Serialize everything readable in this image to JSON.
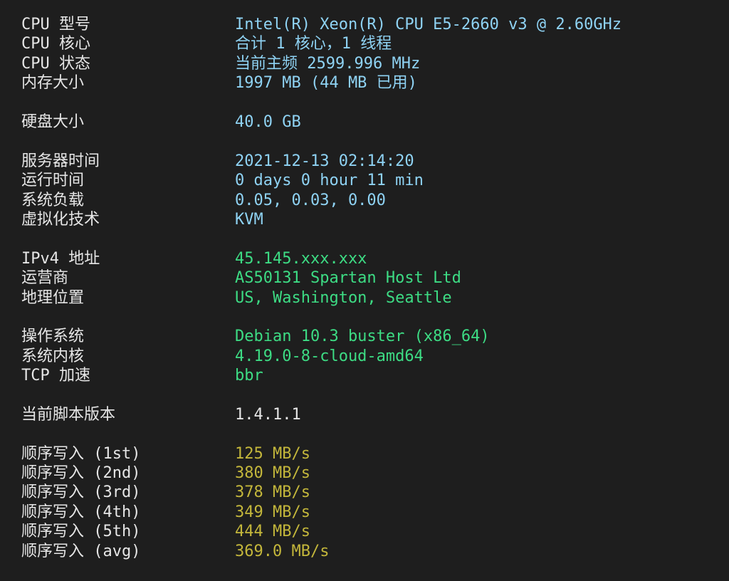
{
  "colors": {
    "background": "#1e1e1e",
    "label": "#e6e6e6",
    "system_value": "#8fd3f4",
    "network_os_value": "#3ddc84",
    "script_version_value": "#e6e6e6",
    "io_value": "#c4b73b"
  },
  "system": [
    {
      "label": "CPU 型号",
      "value": "Intel(R) Xeon(R) CPU E5-2660 v3 @ 2.60GHz"
    },
    {
      "label": "CPU 核心",
      "value": "合计 1 核心，1 线程"
    },
    {
      "label": "CPU 状态",
      "value": "当前主频 2599.996 MHz"
    },
    {
      "label": "内存大小",
      "value": "1997 MB (44 MB 已用)"
    },
    {
      "label": "硬盘大小",
      "value": "40.0 GB"
    },
    {
      "label": "服务器时间",
      "value": "2021-12-13 02:14:20"
    },
    {
      "label": "运行时间",
      "value": "0 days 0 hour 11 min"
    },
    {
      "label": "系统负载",
      "value": "0.05, 0.03, 0.00"
    },
    {
      "label": "虚拟化技术",
      "value": "KVM"
    }
  ],
  "network": [
    {
      "label": "IPv4 地址",
      "value": "45.145.xxx.xxx"
    },
    {
      "label": "运营商",
      "value": "AS50131 Spartan Host Ltd"
    },
    {
      "label": "地理位置",
      "value": "US, Washington, Seattle"
    }
  ],
  "os": [
    {
      "label": "操作系统",
      "value": "Debian 10.3 buster (x86_64)"
    },
    {
      "label": "系统内核",
      "value": "4.19.0-8-cloud-amd64"
    },
    {
      "label": "TCP 加速",
      "value": "bbr"
    }
  ],
  "script": [
    {
      "label": "当前脚本版本",
      "value": "1.4.1.1"
    }
  ],
  "io": [
    {
      "label": "顺序写入 (1st)",
      "value": "125 MB/s"
    },
    {
      "label": "顺序写入 (2nd)",
      "value": "380 MB/s"
    },
    {
      "label": "顺序写入 (3rd)",
      "value": "378 MB/s"
    },
    {
      "label": "顺序写入 (4th)",
      "value": "349 MB/s"
    },
    {
      "label": "顺序写入 (5th)",
      "value": "444 MB/s"
    },
    {
      "label": "顺序写入 (avg)",
      "value": "369.0 MB/s"
    }
  ]
}
